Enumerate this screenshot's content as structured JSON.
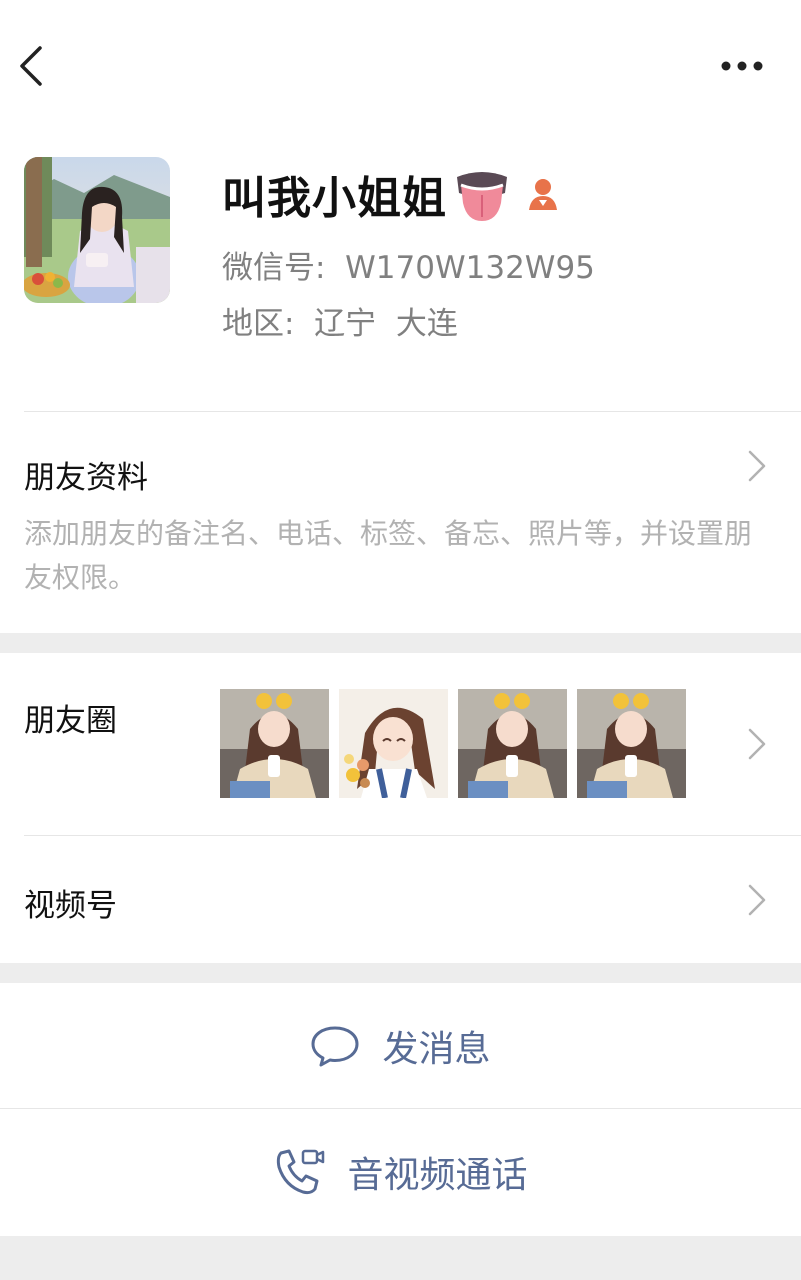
{
  "profile": {
    "nickname": "叫我小姐姐",
    "wechat_id": "微信号:  W170W132W95",
    "region": "地区:  辽宁  大连"
  },
  "icons": {
    "back": "chevron-left-icon",
    "more": "more-dots-icon",
    "emoji": "tongue-out-emoji-icon",
    "gender": "female-person-icon",
    "message": "chat-bubble-icon",
    "call": "phone-video-icon"
  },
  "friend_info": {
    "title": "朋友资料",
    "description": "添加朋友的备注名、电话、标签、备忘、照片等，并设置朋友权限。"
  },
  "moments": {
    "title": "朋友圈"
  },
  "channels": {
    "title": "视频号"
  },
  "actions": {
    "message_label": "发消息",
    "call_label": "音视频通话"
  },
  "colors": {
    "link_blue": "#576b95",
    "gender_orange": "#e8734a",
    "secondary_text": "#808080",
    "hint_text": "#b2b2b2",
    "page_gray": "#ededed"
  }
}
